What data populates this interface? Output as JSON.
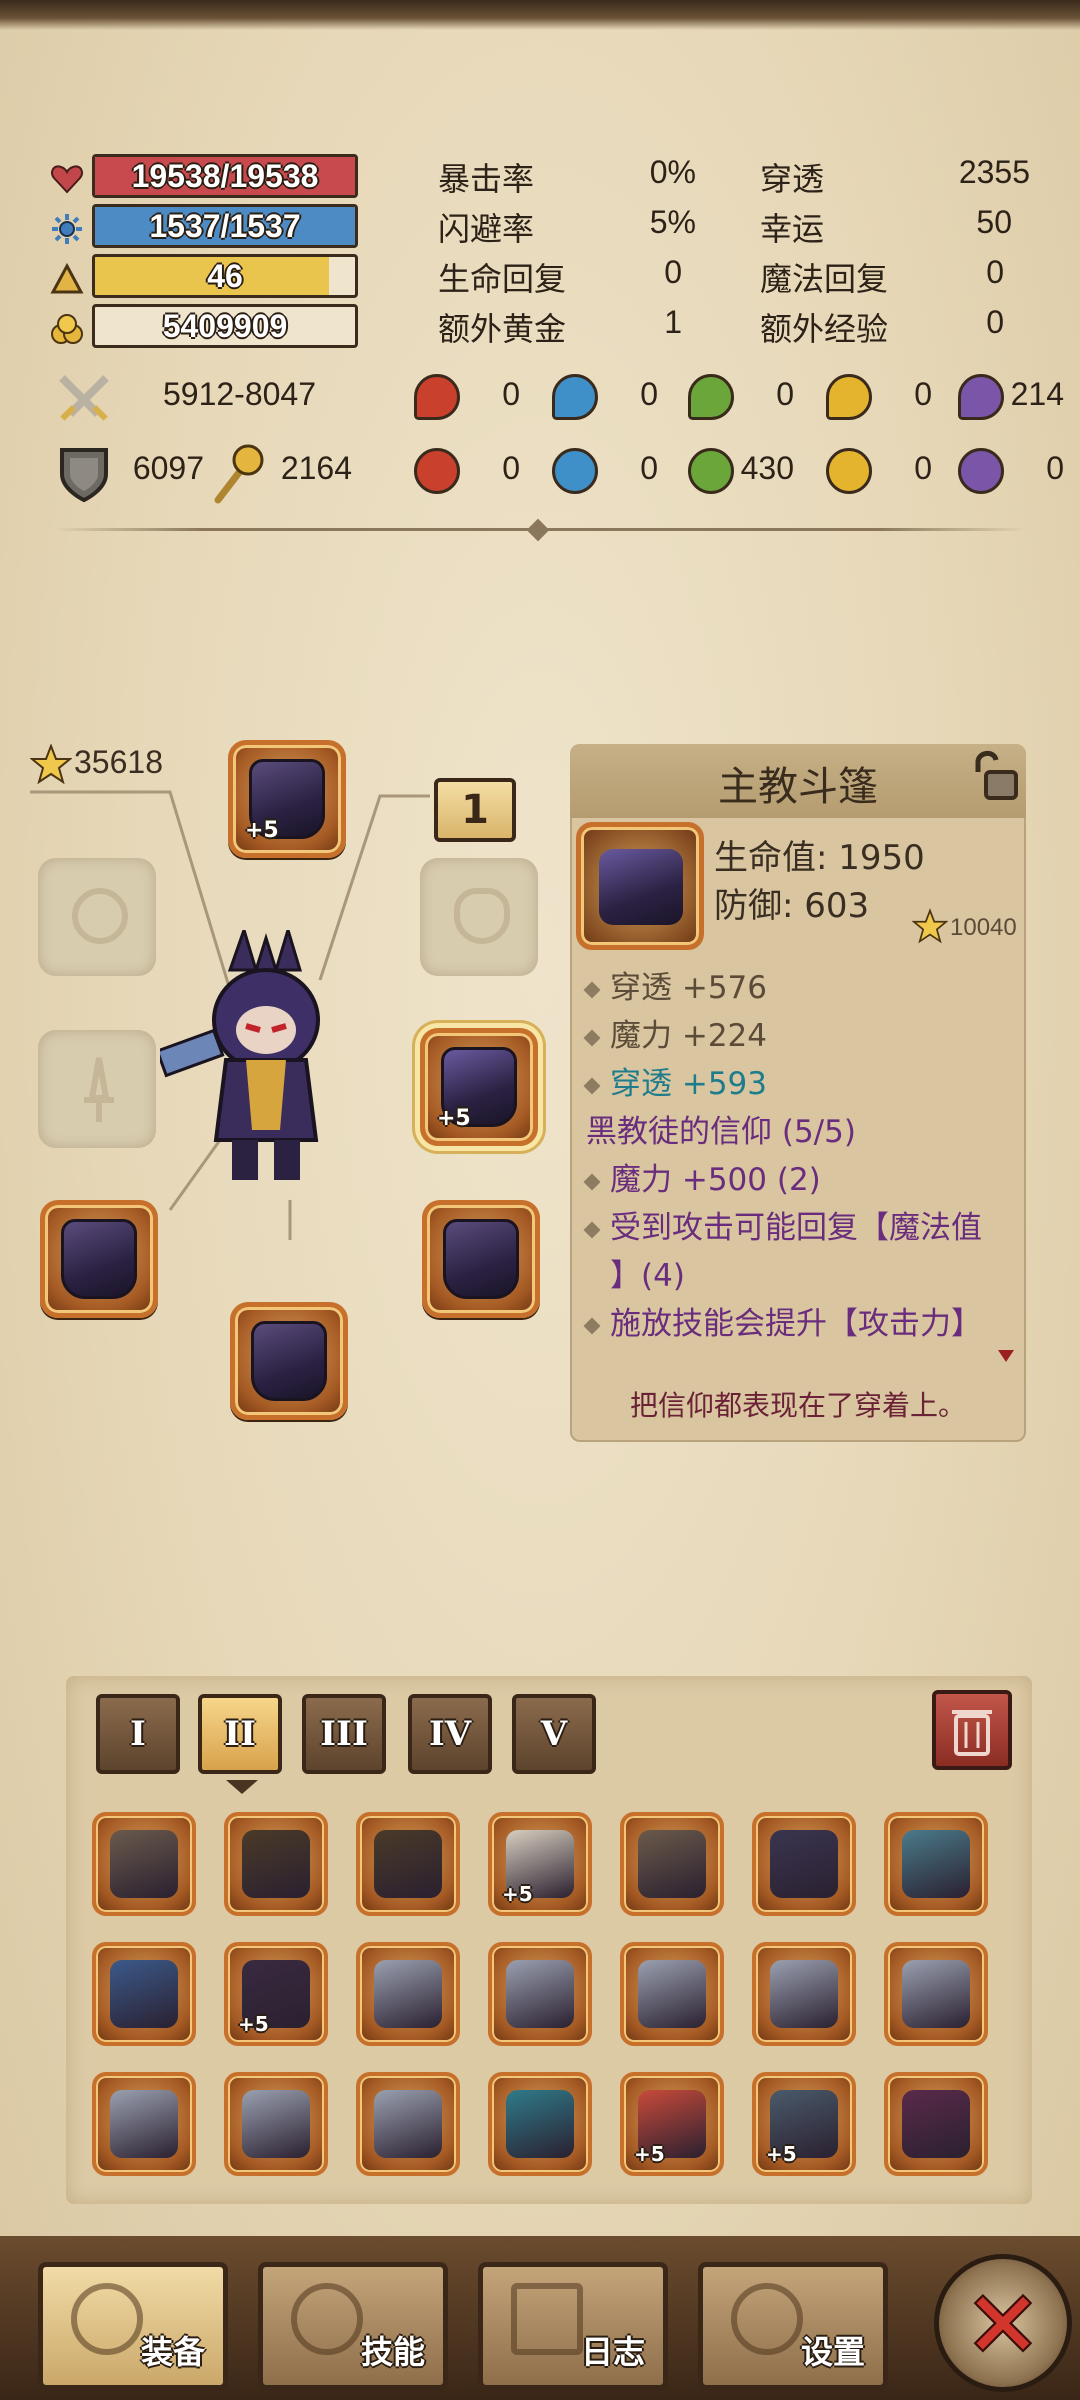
{
  "bars": {
    "hp": {
      "text": "19538/19538",
      "fraction": 1.0,
      "color": "#c94a4e"
    },
    "mp": {
      "text": "1537/1537",
      "fraction": 1.0,
      "color": "#4d8bc4"
    },
    "level": {
      "text": "46",
      "fraction": 0.9,
      "color": "#e9c54e"
    },
    "gold": {
      "text": "5409909",
      "fraction": 0.0,
      "color": "#efe5cd"
    }
  },
  "stats": [
    {
      "label": "暴击率",
      "value": "0%"
    },
    {
      "label": "穿透",
      "value": "2355"
    },
    {
      "label": "闪避率",
      "value": "5%"
    },
    {
      "label": "幸运",
      "value": "50"
    },
    {
      "label": "生命回复",
      "value": "0"
    },
    {
      "label": "魔法回复",
      "value": "0"
    },
    {
      "label": "额外黄金",
      "value": "1"
    },
    {
      "label": "额外经验",
      "value": "0"
    }
  ],
  "attack": "5912-8047",
  "defense": "6097",
  "magic": "2164",
  "element_attack": [
    "0",
    "0",
    "0",
    "0",
    "214"
  ],
  "element_resist": [
    "0",
    "0",
    "430",
    "0",
    "0"
  ],
  "element_colors": [
    "#c9402d",
    "#3f8fc8",
    "#6aa63a",
    "#e4b42f",
    "#7a55a8"
  ],
  "score": "35618",
  "slot_badge": "1",
  "tooltip": {
    "title": "主教斗篷",
    "hp_line": "生命值: 1950",
    "def_line": "防御: 603",
    "score": "10040",
    "lines": [
      {
        "text": "穿透 +576",
        "color": "#5b4b38",
        "diamond": true
      },
      {
        "text": "魔力 +224",
        "color": "#5b4b38",
        "diamond": true
      },
      {
        "text": "穿透 +593",
        "color": "#1f7c8c",
        "diamond": true
      },
      {
        "text": "黑教徒的信仰 (5/5)",
        "color": "#6a2d7e",
        "diamond": false
      },
      {
        "text": "魔力 +500 (2)",
        "color": "#6a2d7e",
        "diamond": true
      },
      {
        "text": "受到攻击可能回复【魔法值",
        "color": "#6a2d7e",
        "diamond": true
      },
      {
        "text": "】(4)",
        "color": "#6a2d7e",
        "diamond": false
      },
      {
        "text": "施放技能会提升【攻击力】",
        "color": "#6a2d7e",
        "diamond": true
      }
    ],
    "flavor": "把信仰都表现在了穿着上。"
  },
  "equip_plus": "+5",
  "tabs": [
    "I",
    "II",
    "III",
    "IV",
    "V"
  ],
  "active_tab": 1,
  "inventory": [
    {
      "plus": ""
    },
    {
      "plus": ""
    },
    {
      "plus": ""
    },
    {
      "plus": "+5"
    },
    {
      "plus": ""
    },
    {
      "plus": ""
    },
    {
      "plus": ""
    },
    {
      "plus": ""
    },
    {
      "plus": "+5"
    },
    {
      "plus": ""
    },
    {
      "plus": ""
    },
    {
      "plus": ""
    },
    {
      "plus": ""
    },
    {
      "plus": ""
    },
    {
      "plus": ""
    },
    {
      "plus": ""
    },
    {
      "plus": ""
    },
    {
      "plus": ""
    },
    {
      "plus": "+5"
    },
    {
      "plus": "+5"
    },
    {
      "plus": ""
    }
  ],
  "nav": [
    "装备",
    "技能",
    "日志",
    "设置"
  ],
  "icons": {
    "hp": "heart-icon",
    "mp": "mana-icon",
    "level": "level-triangle-icon",
    "gold": "gold-coins-icon",
    "attack": "crossed-swords-icon",
    "defense": "shield-icon",
    "magic": "magic-staff-icon",
    "lock": "lock-icon",
    "trash": "trash-icon",
    "close": "close-icon"
  }
}
